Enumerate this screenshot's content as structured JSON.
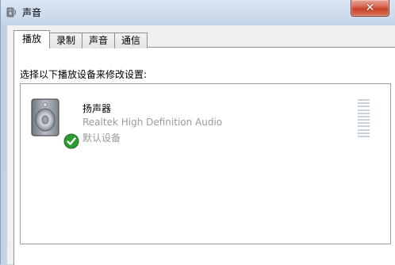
{
  "window": {
    "title": "声音",
    "close_label": "✕"
  },
  "tabs": [
    {
      "label": "播放",
      "active": true
    },
    {
      "label": "录制",
      "active": false
    },
    {
      "label": "声音",
      "active": false
    },
    {
      "label": "通信",
      "active": false
    }
  ],
  "playback": {
    "instruction": "选择以下播放设备来修改设置:",
    "devices": [
      {
        "name": "扬声器",
        "description": "Realtek High Definition Audio",
        "status": "默认设备",
        "icon": "speaker-icon",
        "default_badge_icon": "green-check-icon",
        "level": 0
      }
    ]
  },
  "colors": {
    "close_button": "#c6432a",
    "client_background": "#f0f0f0",
    "muted_text": "#9a9a9a",
    "check_green": "#2e9b33"
  }
}
